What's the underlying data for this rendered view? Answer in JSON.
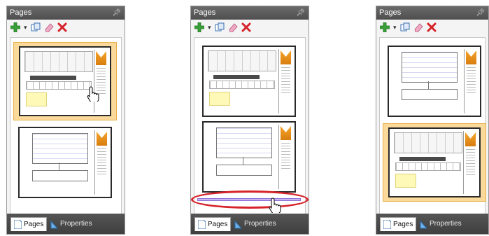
{
  "icons": {
    "pin": "pin-icon",
    "add": "add-page-icon",
    "dropdown": "dropdown-arrow-icon",
    "duplicate": "duplicate-page-icon",
    "rename": "eraser-icon",
    "delete": "delete-icon",
    "pages_tab": "page-icon",
    "properties_tab": "ruler-triangle-icon",
    "cursor": "hand-cursor-icon"
  },
  "colors": {
    "selection": "#fbd99a",
    "delete": "#d6232a",
    "add": "#3aa13a",
    "drop_indicator": "#8b6fd6"
  },
  "panels": [
    {
      "title": "Pages",
      "tabs": [
        "Pages",
        "Properties"
      ],
      "active_tab": "Pages",
      "slots": [
        {
          "selected": true,
          "thumb": "report"
        },
        {
          "selected": false,
          "thumb": "diagram"
        }
      ],
      "cursor_over": "slot-1",
      "drag_indicator": false
    },
    {
      "title": "Pages",
      "tabs": [
        "Pages",
        "Properties"
      ],
      "active_tab": "Pages",
      "slots": [
        {
          "selected": false,
          "thumb": "report"
        },
        {
          "selected": false,
          "thumb": "diagram"
        }
      ],
      "cursor_over": "drop-target",
      "drag_indicator": true
    },
    {
      "title": "Pages",
      "tabs": [
        "Pages",
        "Properties"
      ],
      "active_tab": "Pages",
      "slots": [
        {
          "selected": false,
          "thumb": "diagram"
        },
        {
          "selected": true,
          "thumb": "report"
        }
      ],
      "cursor_over": "none",
      "drag_indicator": false
    }
  ]
}
